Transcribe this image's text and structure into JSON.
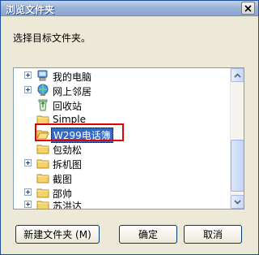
{
  "window": {
    "title": "浏览文件夹",
    "prompt": "选择目标文件夹。"
  },
  "tree": {
    "items": [
      {
        "label": "我的电脑",
        "icon": "my-computer-icon",
        "expandable": true
      },
      {
        "label": "网上邻居",
        "icon": "network-places-icon",
        "expandable": true
      },
      {
        "label": "回收站",
        "icon": "recycle-bin-icon",
        "expandable": false
      },
      {
        "label": "Simple",
        "icon": "folder-icon",
        "expandable": false
      },
      {
        "label": "W299电话簿",
        "icon": "folder-icon",
        "expandable": false,
        "selected": true
      },
      {
        "label": "包劲松",
        "icon": "folder-icon",
        "expandable": false
      },
      {
        "label": "拆机图",
        "icon": "folder-icon",
        "expandable": true
      },
      {
        "label": "截图",
        "icon": "folder-icon",
        "expandable": false
      },
      {
        "label": "邵帅",
        "icon": "folder-icon",
        "expandable": true
      },
      {
        "label": "苏洪达",
        "icon": "folder-icon",
        "expandable": true
      }
    ]
  },
  "buttons": {
    "new_folder": "新建文件夹 (M)",
    "ok": "确定",
    "cancel": "取消"
  },
  "colors": {
    "selection": "#316ac5",
    "highlight_box": "#e00000",
    "folder": "#f4d36a"
  }
}
